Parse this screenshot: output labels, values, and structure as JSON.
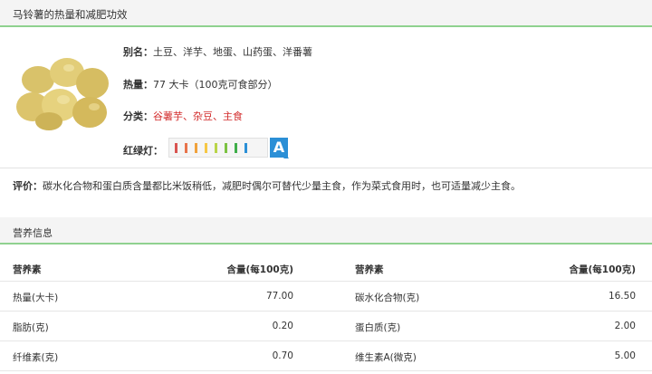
{
  "header": {
    "title": "马铃薯的热量和减肥功效"
  },
  "food": {
    "alias_label": "别名：",
    "alias_value": "土豆、洋芋、地蛋、山药蛋、洋番薯",
    "calorie_label": "热量：",
    "calorie_value": "77 大卡（100克可食部分）",
    "category_label": "分类：",
    "category_value": "谷薯芋、杂豆、主食",
    "rating_label": "红绿灯：",
    "rating_grade": "A",
    "rating_colors": [
      "#d9534f",
      "#e8734a",
      "#f0a23b",
      "#f6c744",
      "#b9d448",
      "#7cc242",
      "#3fae49",
      "#2b8fd6"
    ]
  },
  "evaluation": {
    "label": "评价：",
    "text": "碳水化合物和蛋白质含量都比米饭稍低，减肥时偶尔可替代少量主食，作为菜式食用时，也可适量减少主食。"
  },
  "nutrition": {
    "title": "营养信息",
    "col_nutrient": "营养素",
    "col_amount": "含量(每100克)",
    "left": [
      {
        "name": "热量(大卡)",
        "value": "77.00"
      },
      {
        "name": "脂肪(克)",
        "value": "0.20"
      },
      {
        "name": "纤维素(克)",
        "value": "0.70"
      }
    ],
    "right": [
      {
        "name": "碳水化合物(克)",
        "value": "16.50"
      },
      {
        "name": "蛋白质(克)",
        "value": "2.00"
      },
      {
        "name": "维生素A(微克)",
        "value": "5.00"
      }
    ]
  }
}
